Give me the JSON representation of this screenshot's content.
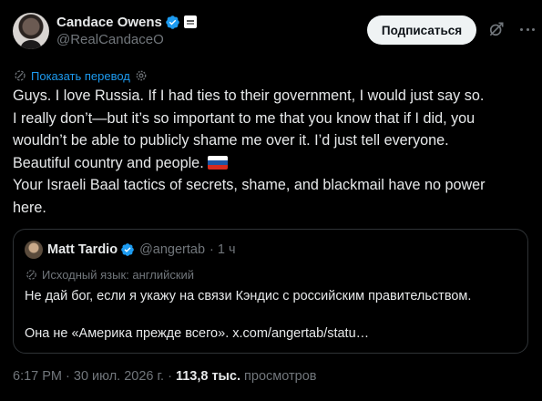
{
  "author": {
    "name": "Candace Owens",
    "handle": "@RealCandaceO"
  },
  "actions": {
    "subscribe_label": "Подписаться",
    "grok_icon": "grok-icon",
    "more_icon": "more-icon"
  },
  "translate_link": "Показать перевод",
  "tweet": {
    "lines": [
      "Guys. I love Russia. If I had ties to their government, I would just say so.",
      "I really don’t—but it’s so important to me that you know that if I did, you",
      "wouldn’t be able to publicly shame me over it. I’d just tell everyone.",
      "Beautiful country and people.",
      "Your Israeli Baal tactics of secrets, shame, and blackmail have no power",
      "here."
    ]
  },
  "quote": {
    "name": "Matt Tardio",
    "handle": "@angertab",
    "time": "· 1 ч",
    "source_lang": "Исходный язык: английский",
    "line1": "Не дай бог, если я укажу на связи Кэндис с российским правительством.",
    "line2": "Она не «Америка прежде всего». x.com/angertab/statu…"
  },
  "meta": {
    "datetime": "6:17 PM · 30 июл. 2026 г. · ",
    "views_count": "113,8 тыс.",
    "views_label": " просмотров"
  },
  "colors": {
    "background": "#000000",
    "text": "#e7e9ea",
    "muted": "#71767b",
    "accent": "#1d9bf0",
    "border": "#2f3336"
  }
}
